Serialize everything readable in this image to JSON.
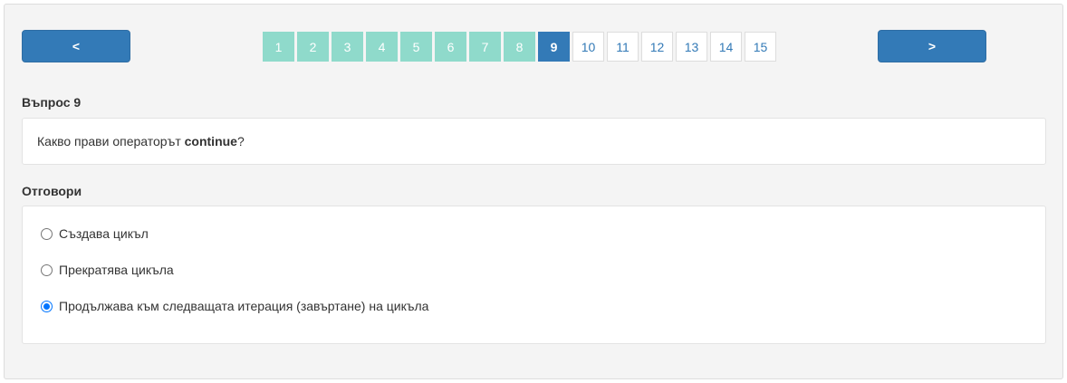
{
  "navigation": {
    "prev_label": "<",
    "next_label": ">"
  },
  "pager": {
    "pages": [
      {
        "label": "1",
        "state": "answered"
      },
      {
        "label": "2",
        "state": "answered"
      },
      {
        "label": "3",
        "state": "answered"
      },
      {
        "label": "4",
        "state": "answered"
      },
      {
        "label": "5",
        "state": "answered"
      },
      {
        "label": "6",
        "state": "answered"
      },
      {
        "label": "7",
        "state": "answered"
      },
      {
        "label": "8",
        "state": "answered"
      },
      {
        "label": "9",
        "state": "current"
      },
      {
        "label": "10",
        "state": "unanswered"
      },
      {
        "label": "11",
        "state": "unanswered"
      },
      {
        "label": "12",
        "state": "unanswered"
      },
      {
        "label": "13",
        "state": "unanswered"
      },
      {
        "label": "14",
        "state": "unanswered"
      },
      {
        "label": "15",
        "state": "unanswered"
      }
    ]
  },
  "question": {
    "heading": "Въпрос 9",
    "text_before": "Какво прави операторът ",
    "keyword": "continue",
    "text_after": "?"
  },
  "answers": {
    "heading": "Отговори",
    "options": [
      {
        "label": "Създава цикъл",
        "selected": false
      },
      {
        "label": "Прекратява цикъла",
        "selected": false
      },
      {
        "label": "Продължава към следващата итерация (завъртане) на цикъла",
        "selected": true
      }
    ]
  },
  "colors": {
    "primary": "#337ab7",
    "answered": "#8fdacb",
    "radio_checked": "#0075ff"
  }
}
